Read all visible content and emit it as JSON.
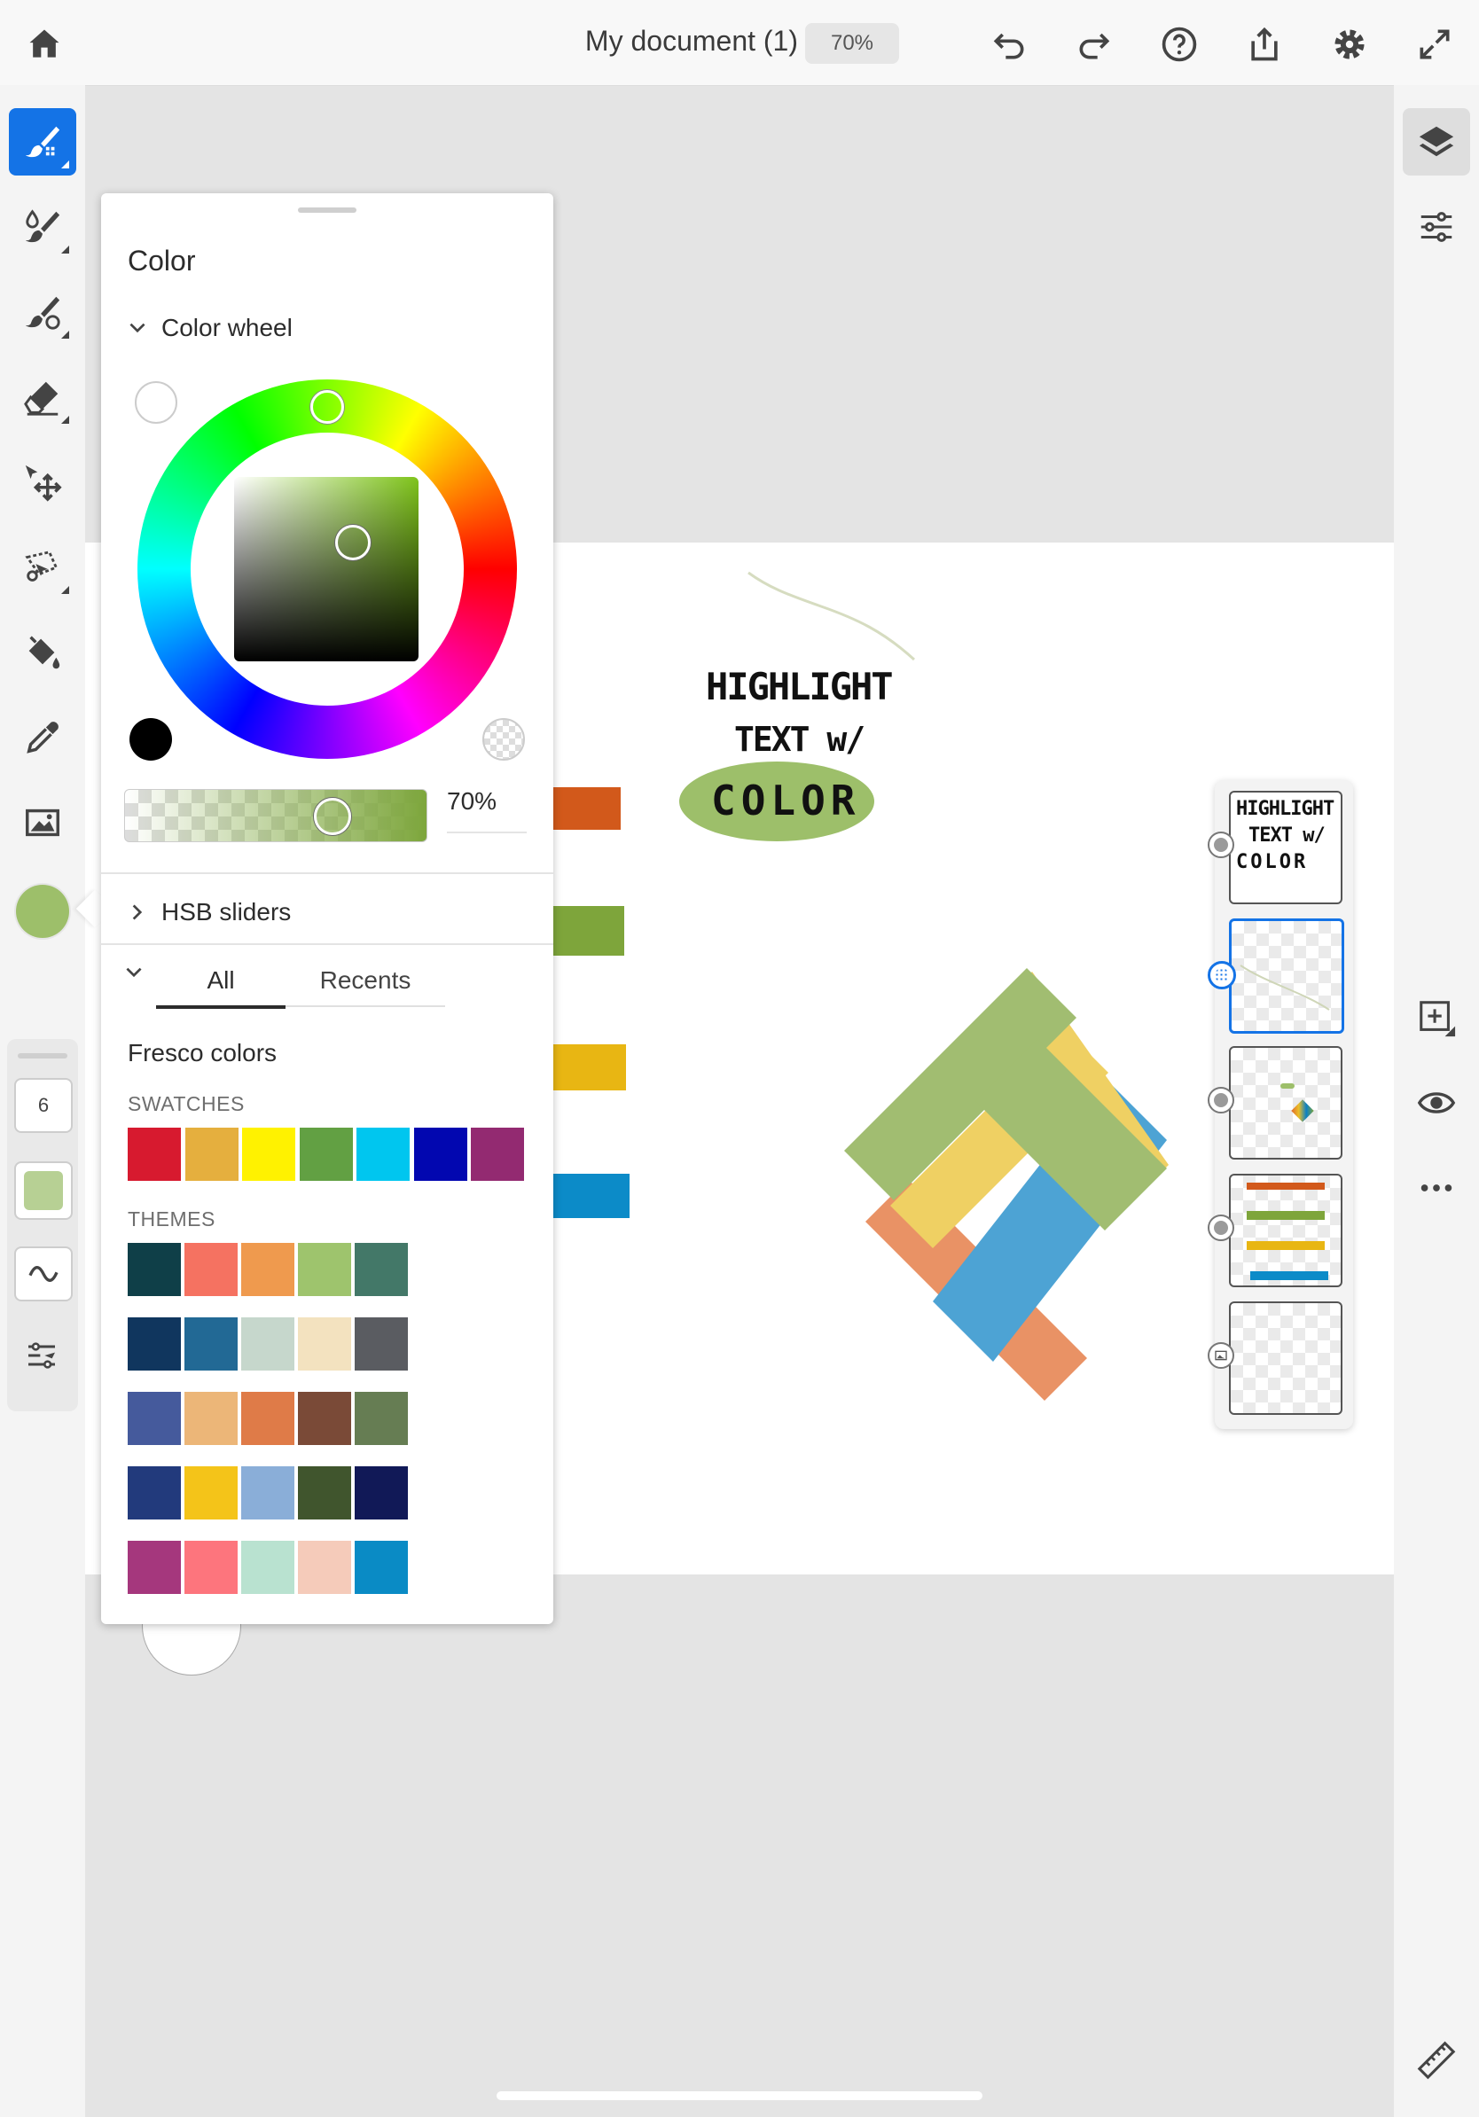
{
  "topbar": {
    "title": "My document (1)",
    "zoom": "70%",
    "icons": [
      "home-icon",
      "undo-icon",
      "redo-icon",
      "help-icon",
      "share-icon",
      "gear-icon",
      "fullscreen-icon"
    ]
  },
  "left_toolbar": {
    "tools": [
      "pixel-brush-icon",
      "live-brush-icon",
      "vector-brush-icon",
      "eraser-icon",
      "move-icon",
      "selection-icon",
      "fill-icon",
      "eyedropper-icon",
      "image-icon"
    ],
    "current_color": "#9dbf6a",
    "brush_size": "6"
  },
  "right_toolbar": {
    "icons": [
      "layers-icon",
      "layer-properties-icon",
      "add-layer-icon",
      "visibility-icon",
      "more-icon",
      "ruler-icon"
    ]
  },
  "color_panel": {
    "title": "Color",
    "section_color_wheel": "Color wheel",
    "opacity_value": "70%",
    "section_hsb": "HSB sliders",
    "tabs": [
      "All",
      "Recents"
    ],
    "active_tab": "All",
    "library_name": "Fresco colors",
    "swatches_label": "SWATCHES",
    "swatches": [
      "#d71a2f",
      "#e5af3e",
      "#fff200",
      "#62a043",
      "#00c6ef",
      "#0207b0",
      "#932a71"
    ],
    "themes_label": "THEMES",
    "themes": [
      [
        "#0f3f48",
        "#f57261",
        "#ef9a4e",
        "#9ec46d",
        "#437868"
      ],
      [
        "#10365e",
        "#226995",
        "#c6d7cc",
        "#f3e2bf",
        "#5a5c61"
      ],
      [
        "#455a9c",
        "#ecb678",
        "#df7b48",
        "#7a4a37",
        "#667d53"
      ],
      [
        "#223a7c",
        "#f4c419",
        "#8aaed8",
        "#40552d",
        "#111957"
      ],
      [
        "#a5377d",
        "#fd757d",
        "#b9e2d0",
        "#f5cbba",
        "#0a8bc5"
      ]
    ]
  },
  "canvas": {
    "handwriting": [
      "HIGHLIGHT",
      "TEXT w/",
      "COLOR"
    ],
    "highlight_color": "#9dbf6a",
    "stripe_colors": [
      "#d2591b",
      "#7ea53b",
      "#e8b613",
      "#0c8bc8"
    ]
  }
}
